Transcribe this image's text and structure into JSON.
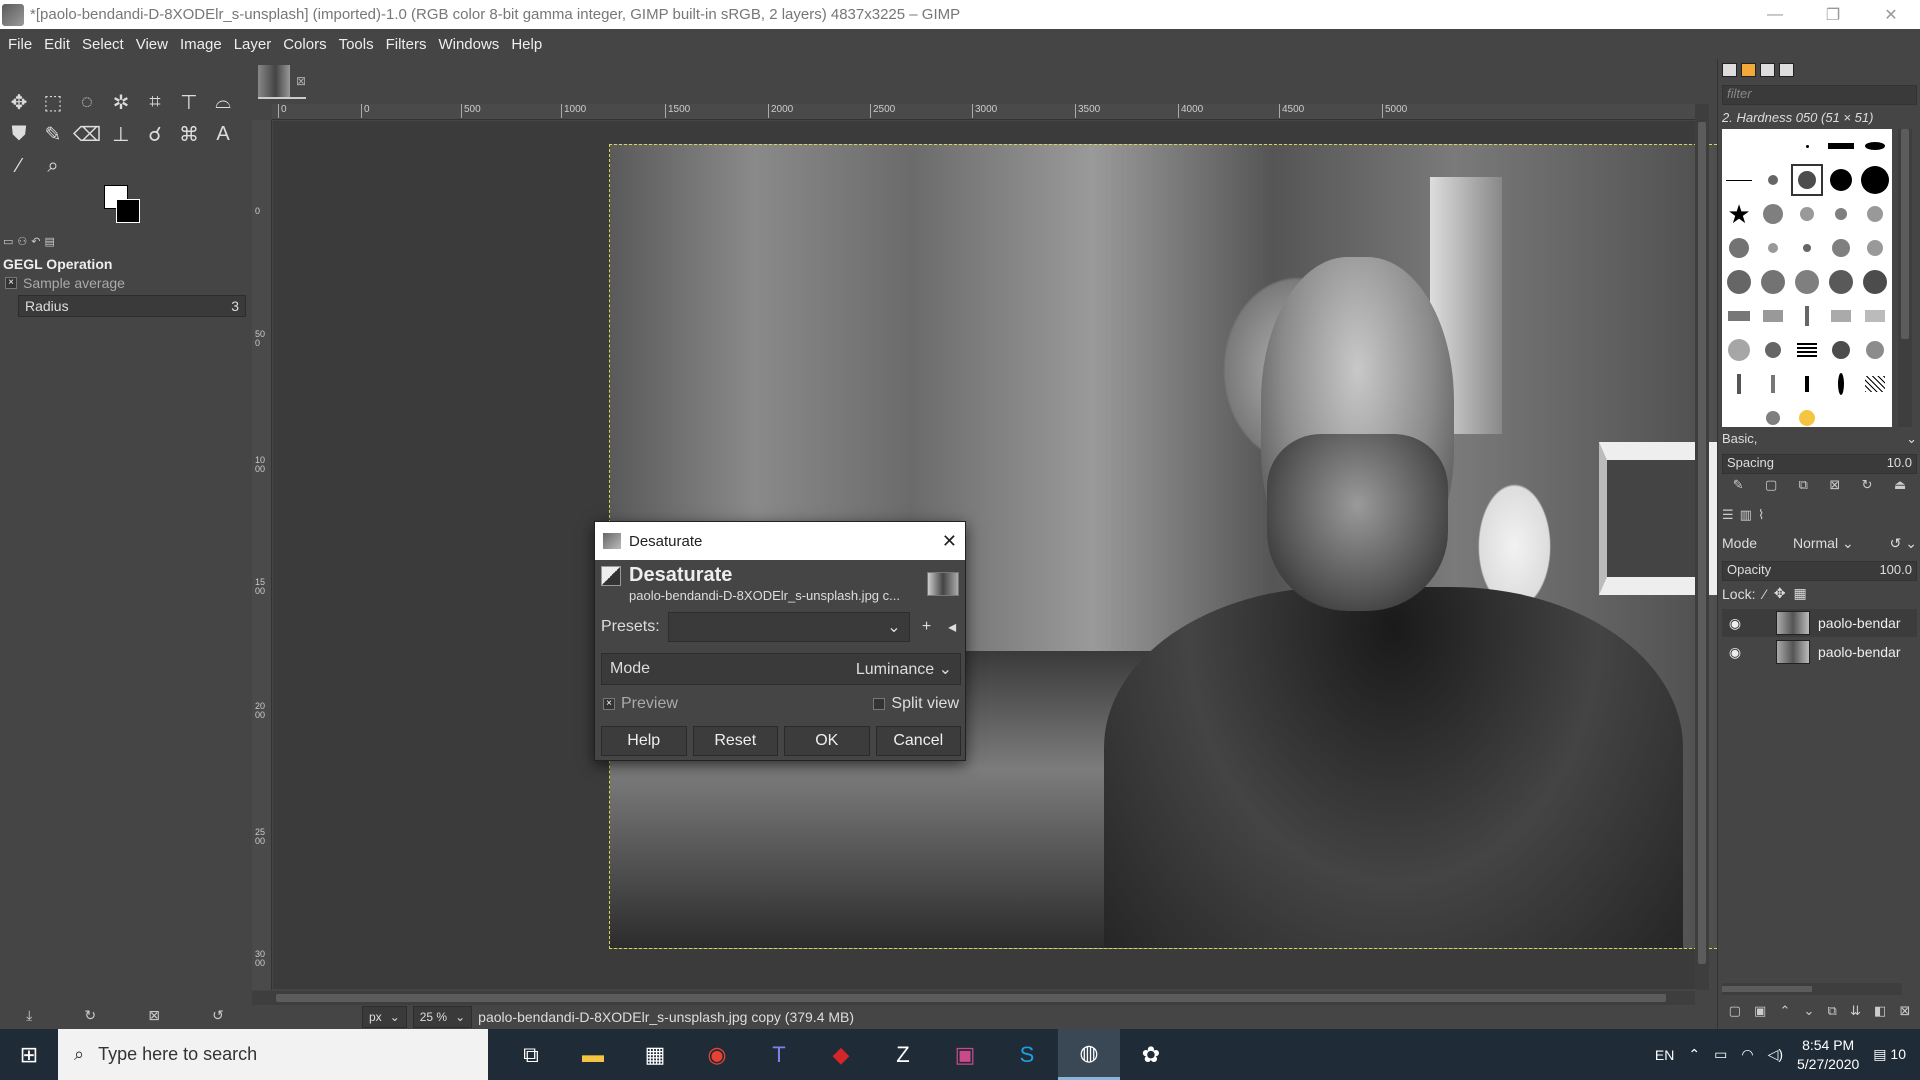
{
  "window": {
    "title": "*[paolo-bendandi-D-8XODElr_s-unsplash] (imported)-1.0 (RGB color 8-bit gamma integer, GIMP built-in sRGB, 2 layers) 4837x3225 – GIMP",
    "minimize": "—",
    "maximize": "❐",
    "close": "✕"
  },
  "menu": [
    "File",
    "Edit",
    "Select",
    "View",
    "Image",
    "Layer",
    "Colors",
    "Tools",
    "Filters",
    "Windows",
    "Help"
  ],
  "tool_options": {
    "title": "GEGL Operation",
    "sample_average": "Sample average",
    "radius_label": "Radius",
    "radius_value": "3"
  },
  "ruler": {
    "top": [
      "0",
      "500",
      "1000",
      "1500",
      "2000",
      "2500",
      "3000",
      "3500",
      "4000",
      "4500",
      "5000"
    ],
    "left": [
      "0",
      "500",
      "1000",
      "1500",
      "2000",
      "2500",
      "3000"
    ]
  },
  "statusbar": {
    "unit": "px",
    "zoom": "25 %",
    "message": "paolo-bendandi-D-8XODElr_s-unsplash.jpg copy (379.4 MB)"
  },
  "dialog": {
    "window_title": "Desaturate",
    "header_title": "Desaturate",
    "header_subtitle": "paolo-bendandi-D-8XODElr_s-unsplash.jpg c...",
    "presets_label": "Presets:",
    "presets_value": "",
    "mode_label": "Mode",
    "mode_value": "Luminance",
    "preview_label": "Preview",
    "split_view_label": "Split view",
    "buttons": {
      "help": "Help",
      "reset": "Reset",
      "ok": "OK",
      "cancel": "Cancel"
    }
  },
  "brushes": {
    "filter_placeholder": "filter",
    "selected_name": "2. Hardness 050 (51 × 51)",
    "set_name": "Basic,",
    "spacing_label": "Spacing",
    "spacing_value": "10.0"
  },
  "layers": {
    "mode_label": "Mode",
    "mode_value": "Normal",
    "opacity_label": "Opacity",
    "opacity_value": "100.0",
    "lock_label": "Lock:",
    "items": [
      {
        "name": "paolo-bendar"
      },
      {
        "name": "paolo-bendar"
      }
    ]
  },
  "taskbar": {
    "search_placeholder": "Type here to search",
    "language": "EN",
    "time": "8:54 PM",
    "date": "5/27/2020",
    "notification_count": "10"
  }
}
